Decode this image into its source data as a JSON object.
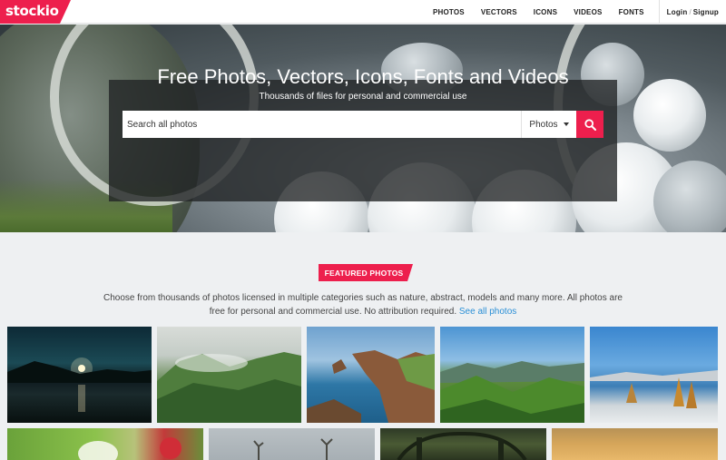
{
  "brand": {
    "logo_text": "stockio",
    "accent": "#ed1f4d"
  },
  "nav": {
    "items": [
      "PHOTOS",
      "VECTORS",
      "ICONS",
      "VIDEOS",
      "FONTS"
    ],
    "login": "Login",
    "separator": "/",
    "signup": "Signup"
  },
  "hero": {
    "title": "Free Photos, Vectors, Icons, Fonts and Videos",
    "subtitle": "Thousands of files for personal and commercial use",
    "search": {
      "placeholder": "Search all photos",
      "category": "Photos",
      "button_icon": "search-icon"
    }
  },
  "featured": {
    "badge": "FEATURED PHOTOS",
    "description_line1": "Choose from thousands of photos licensed in multiple categories such as nature, abstract, models and many more. All photos are",
    "description_line2": "free for personal and commercial use. No attribution required.",
    "link": "See all photos"
  },
  "photos": [
    {
      "name": "night-lake"
    },
    {
      "name": "misty-forest-hills"
    },
    {
      "name": "coastal-cliffs"
    },
    {
      "name": "green-valley"
    },
    {
      "name": "lake-autumn-trees"
    },
    {
      "name": "flower-closeup"
    },
    {
      "name": "branches-sky"
    },
    {
      "name": "dark-forest"
    },
    {
      "name": "sunset-sky"
    }
  ]
}
